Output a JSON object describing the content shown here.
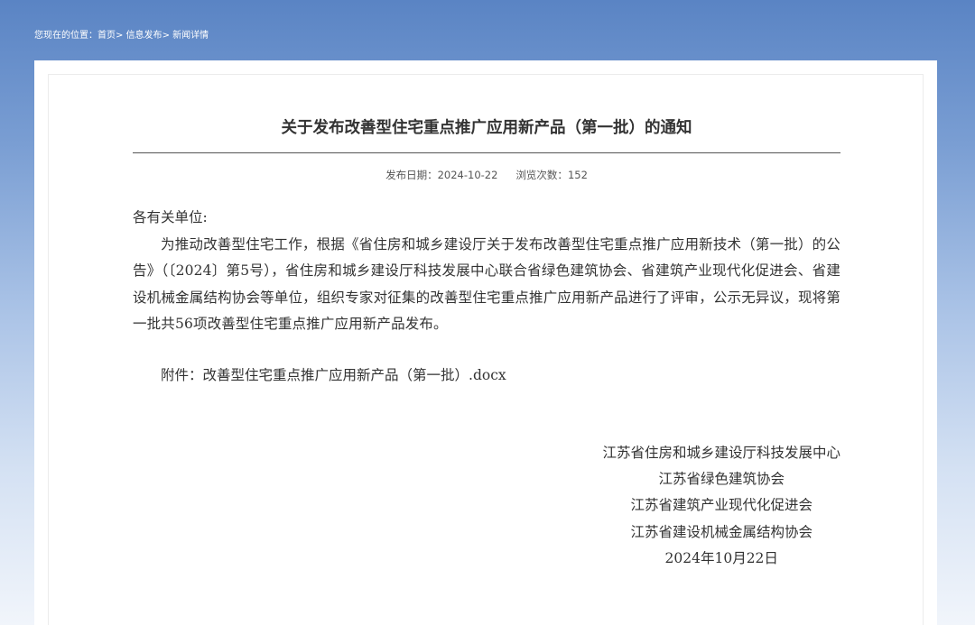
{
  "breadcrumb": {
    "prefix": "您现在的位置：",
    "items": [
      "首页",
      "信息发布",
      "新闻详情"
    ],
    "separator": "> "
  },
  "article": {
    "title": "关于发布改善型住宅重点推广应用新产品（第一批）的通知",
    "publish_date_label": "发布日期：",
    "publish_date": "2024-10-22",
    "views_label": "浏览次数：",
    "views": "152",
    "salutation": "各有关单位:",
    "paragraph": "为推动改善型住宅工作，根据《省住房和城乡建设厅关于发布改善型住宅重点推广应用新技术（第一批）的公告》（〔2024〕第5号），省住房和城乡建设厅科技发展中心联合省绿色建筑协会、省建筑产业现代化促进会、省建设机械金属结构协会等单位，组织专家对征集的改善型住宅重点推广应用新产品进行了评审，公示无异议，现将第一批共56项改善型住宅重点推广应用新产品发布。",
    "attachment_label": "附件：",
    "attachment_name": "改善型住宅重点推广应用新产品（第一批）.docx",
    "signatories": [
      "江苏省住房和城乡建设厅科技发展中心",
      "江苏省绿色建筑协会",
      "江苏省建筑产业现代化促进会",
      "江苏省建设机械金属结构协会"
    ],
    "date": "2024年10月22日"
  },
  "colors": {
    "header_blue": "#5a84c4",
    "text": "#333333",
    "rule": "#555555"
  }
}
